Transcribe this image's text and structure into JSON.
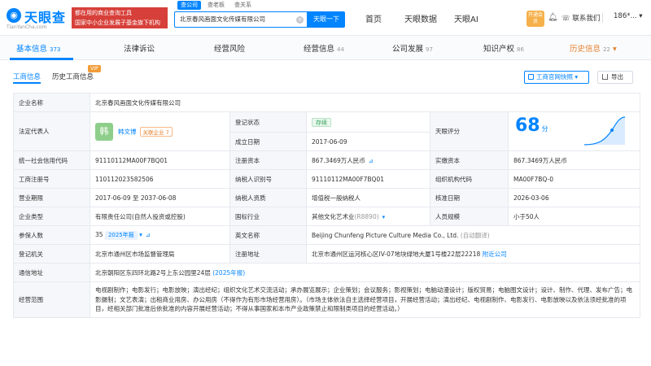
{
  "header": {
    "logo_text": "天眼查",
    "logo_sub": "TianYanCha.com",
    "promo_line1": "都在用的商业查询工具",
    "promo_line2": "国家中小企业发展子基金旗下机构",
    "search_tabs": [
      "查公司",
      "查老板",
      "查关系"
    ],
    "search_value": "北京春风画面文化传媒有限公司",
    "search_button": "天眼一下",
    "nav": [
      "首页",
      "天眼数据",
      "天眼AI"
    ],
    "vip_label": "开通会员",
    "contact": "联系我们",
    "user": "186*..."
  },
  "tabs": [
    {
      "label": "基本信息",
      "count": "373"
    },
    {
      "label": "法律诉讼",
      "count": ""
    },
    {
      "label": "经营风险",
      "count": ""
    },
    {
      "label": "经营信息",
      "count": "44"
    },
    {
      "label": "公司发展",
      "count": "97"
    },
    {
      "label": "知识产权",
      "count": "86"
    },
    {
      "label": "历史信息",
      "count": "22"
    }
  ],
  "subtabs": [
    "工商信息",
    "历史工商信息"
  ],
  "vip_tag": "VIP",
  "quick_button": "工商官网快照",
  "export_button": "导出",
  "info": {
    "name_label": "企业名称",
    "name": "北京春风画面文化传媒有限公司",
    "rep_label": "法定代表人",
    "rep_avatar": "韩",
    "rep_name": "韩文博",
    "rep_assoc": "关联企业 7",
    "reg_status_label": "登记状态",
    "reg_status": "存续",
    "est_date_label": "成立日期",
    "est_date": "2017-06-09",
    "score_label": "天眼评分",
    "score": "68",
    "score_unit": "分",
    "credit_code_label": "统一社会信用代码",
    "credit_code": "91110112MA00F7BQ01",
    "reg_capital_label": "注册资本",
    "reg_capital": "867.3469万人民币",
    "paid_capital_label": "实缴资本",
    "paid_capital": "867.3469万人民币",
    "biz_reg_no_label": "工商注册号",
    "biz_reg_no": "110112023582506",
    "taxpayer_id_label": "纳税人识别号",
    "taxpayer_id": "91110112MA00F7BQ01",
    "org_code_label": "组织机构代码",
    "org_code": "MA00F7BQ-0",
    "term_label": "营业期限",
    "term": "2017-06-09 至 2037-06-08",
    "tax_qual_label": "纳税人资质",
    "tax_qual": "增值税一般纳税人",
    "approve_date_label": "核准日期",
    "approve_date": "2026-03-06",
    "type_label": "企业类型",
    "type": "有限责任公司(自然人投资或控股)",
    "industry_label": "国标行业",
    "industry": "其他文化艺术业",
    "industry_code": "(R8890)",
    "staff_label": "人员规模",
    "staff": "小于50人",
    "insured_label": "参保人数",
    "insured": "35",
    "insured_year": "2025年报",
    "en_name_label": "英文名称",
    "en_name": "Beijing Chunfeng Picture Culture Media Co., Ltd.",
    "en_name_note": "(自动翻译)",
    "authority_label": "登记机关",
    "authority": "北京市通州区市场监督管理局",
    "reg_addr_label": "注册地址",
    "reg_addr": "北京市通州区运河核心区IV-07地块绿地大厦1号楼22层22218",
    "reg_addr_link": "附近公司",
    "mail_addr_label": "通信地址",
    "mail_addr": "北京朝阳区东四环北路2号上东公园里24层",
    "mail_addr_year": "(2025年报)",
    "scope_label": "经营范围",
    "scope": "电视剧制作；电影发行；电影放映；演出经纪；组织文化艺术交流活动；承办展览展示；企业策划；会议服务；影视策划；电脑动漫设计；版权贸易；电脑图文设计；设计、制作、代理、发布广告；电影摄制；文艺表演；出租商业用房、办公用房（不得作为有形市场经营用房）。（市场主体依法自主选择经营项目，开展经营活动；演出经纪、电视剧制作、电影发行、电影放映以及依法须经批准的项目，经相关部门批准后依批准的内容开展经营活动；不得从事国家和本市产业政策禁止和限制类项目的经营活动。）"
  },
  "colors": {
    "accent": "#0084ff",
    "status_green": "#35a35c",
    "history_orange": "#e6812f"
  }
}
